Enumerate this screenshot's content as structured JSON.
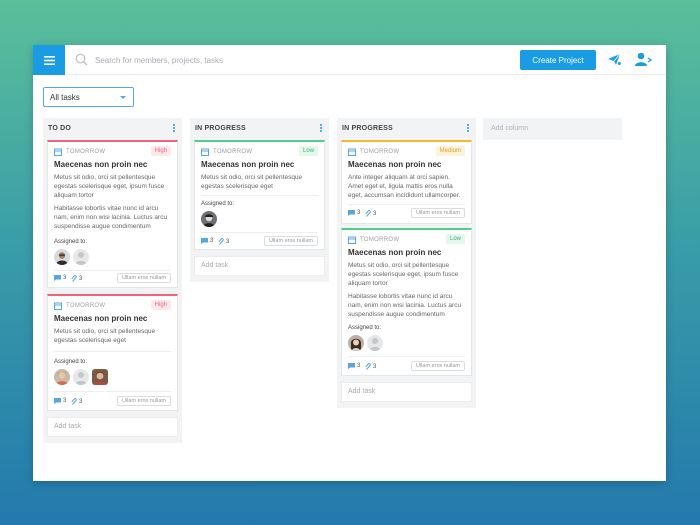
{
  "topbar": {
    "search_placeholder": "Search for members, projects, tasks",
    "create_button": "Create Project"
  },
  "filter": {
    "selected": "All tasks"
  },
  "add_column_label": "Add column",
  "add_task_label": "Add task",
  "assigned_label": "Assigned to:",
  "columns": [
    {
      "title": "TO DO",
      "cards": [
        {
          "due": "TOMORROW",
          "priority": "High",
          "title": "Maecenas non proin nec",
          "desc1": "Metus sit odio, orci sit pellentesque egestas scelerisque eget, ipsum fusce aliquam tortor",
          "desc2": "Habitasse lobortis vitae nunc id arcu nam, enim non wisi lacinia. Luctus arcu suspendisse augue condimentum",
          "comments": "3",
          "attachments": "3",
          "tag": "Ullam eros nullam"
        },
        {
          "due": "TOMORROW",
          "priority": "High",
          "title": "Maecenas non proin nec",
          "desc1": "Metus sit odio, orci sit pellentesque egestas scelerisque eget",
          "comments": "3",
          "attachments": "3",
          "tag": "Ullam eros nullam"
        }
      ]
    },
    {
      "title": "IN PROGRESS",
      "cards": [
        {
          "due": "TOMORROW",
          "priority": "Low",
          "title": "Maecenas non proin nec",
          "desc1": "Metus sit odio, orci sit pellentesque egestas scelerisque eget",
          "comments": "3",
          "attachments": "3",
          "tag": "Ullam eros nullam"
        }
      ]
    },
    {
      "title": "IN PROGRESS",
      "cards": [
        {
          "due": "TOMORROW",
          "priority": "Medium",
          "title": "Maecenas non proin nec",
          "desc1": "Ante integer aliquam at orci sapien. Amet eget et, ligula mattis eros nulla eget, accumsan incididunt ullamcorper.",
          "comments": "3",
          "attachments": "3",
          "tag": "Ullam eros nullam"
        },
        {
          "due": "TOMORROW",
          "priority": "Low",
          "title": "Maecenas non proin nec",
          "desc1": "Metus sit odio, orci sit pellentesque egestas scelerisque eget, ipsum fusce aliquam tortor",
          "desc2": "Habitasse lobortis vitae nunc id arcu nam, enim non wisi lacinia. Luctus arcu suspendisse augue condimentum",
          "comments": "3",
          "attachments": "3",
          "tag": "Ullam eros nullam"
        }
      ]
    }
  ],
  "colors": {
    "accent": "#1a9ce5",
    "high": "#f0637d",
    "low": "#4fcf8a",
    "medium": "#f5b82e"
  }
}
